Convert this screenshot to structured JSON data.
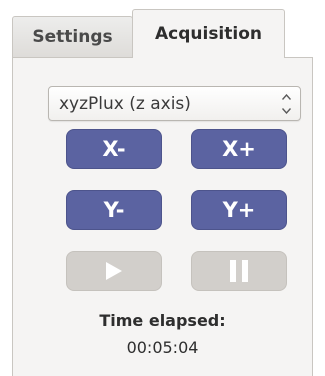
{
  "tabs": [
    {
      "label": "Settings",
      "active": false
    },
    {
      "label": "Acquisition",
      "active": true
    }
  ],
  "axis_select": {
    "selected": "xyzPlux (z axis)"
  },
  "buttons": {
    "x_minus": "X-",
    "x_plus": "X+",
    "y_minus": "Y-",
    "y_plus": "Y+",
    "play_icon": "play-icon",
    "pause_icon": "pause-icon"
  },
  "timer": {
    "label": "Time elapsed:",
    "value": "00:05:04"
  },
  "colors": {
    "button_active": "#5b63a1",
    "button_disabled": "#d2cfcb",
    "panel_bg": "#f5f4f3"
  }
}
